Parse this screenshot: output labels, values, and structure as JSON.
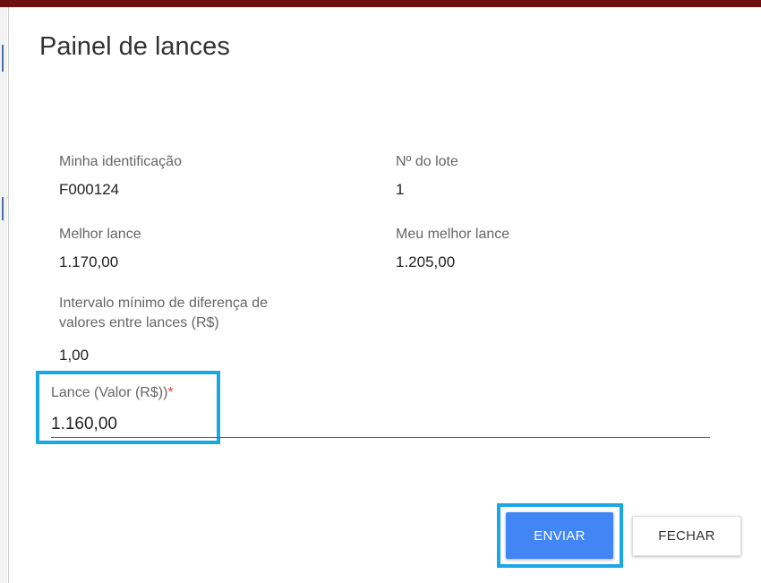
{
  "dialog": {
    "title": "Painel de lances"
  },
  "fields": {
    "identificacao": {
      "label": "Minha identificação",
      "value": "F000124"
    },
    "lote": {
      "label": "Nº do lote",
      "value": "1"
    },
    "melhor_lance": {
      "label": "Melhor lance",
      "value": "1.170,00"
    },
    "meu_melhor_lance": {
      "label": "Meu melhor lance",
      "value": "1.205,00"
    },
    "intervalo": {
      "label_line1": "Intervalo mínimo de diferença de",
      "label_line2": "valores entre lances (R$)",
      "value": "1,00"
    }
  },
  "lance_input": {
    "label": "Lance (Valor (R$))",
    "required_mark": "*",
    "value": "1.160,00"
  },
  "actions": {
    "send_label": "ENVIAR",
    "close_label": "FECHAR"
  },
  "colors": {
    "header_bar": "#6b0f0f",
    "primary_button": "#4285f4",
    "highlight_outline": "#1aa7e6",
    "error_underline": "#d32f2f"
  }
}
